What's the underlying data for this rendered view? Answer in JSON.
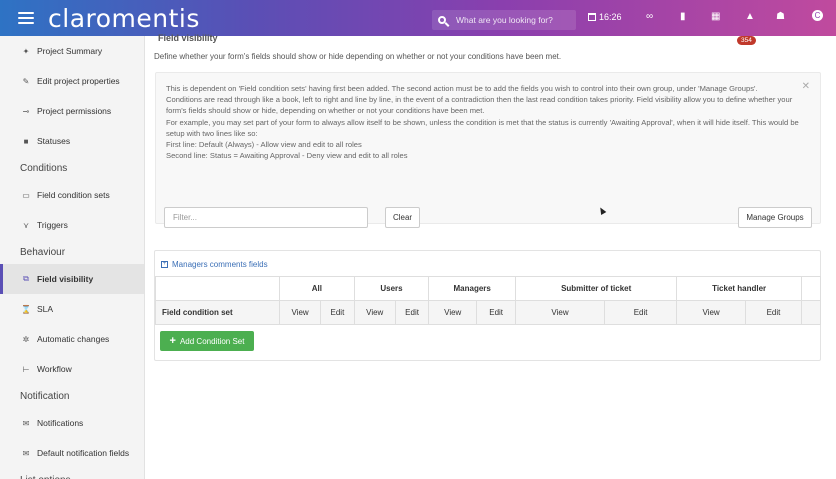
{
  "header": {
    "logo": "claromentis",
    "search_placeholder": "What are you looking for?",
    "time": "16:26",
    "notification_count": "354"
  },
  "sidebar": {
    "items": [
      {
        "label": "Project Summary",
        "icon": "pin-icon"
      },
      {
        "label": "Edit project properties",
        "icon": "pencil-icon"
      },
      {
        "label": "Project permissions",
        "icon": "key-icon"
      },
      {
        "label": "Statuses",
        "icon": "folder-icon"
      }
    ],
    "section_conditions": "Conditions",
    "conditions_items": [
      {
        "label": "Field condition sets",
        "icon": "rectangle-icon"
      },
      {
        "label": "Triggers",
        "icon": "trigger-icon"
      }
    ],
    "section_behaviour": "Behaviour",
    "behaviour_items": [
      {
        "label": "Field visibility",
        "icon": "visibility-icon",
        "active": true
      },
      {
        "label": "SLA",
        "icon": "hourglass-icon"
      },
      {
        "label": "Automatic changes",
        "icon": "magic-icon"
      },
      {
        "label": "Workflow",
        "icon": "flow-icon"
      }
    ],
    "section_notification": "Notification",
    "notification_items": [
      {
        "label": "Notifications",
        "icon": "envelope-icon"
      },
      {
        "label": "Default notification fields",
        "icon": "envelope-star-icon"
      }
    ],
    "section_list": "List options"
  },
  "main": {
    "title": "Field visibility",
    "description": "Define whether your form's fields should show or hide depending on whether or not your conditions have been met.",
    "info_lines": [
      "This is dependent on 'Field condition sets' having first been added. The second action must be to add the fields you wish to control into their own group, under 'Manage Groups'.",
      "Conditions are read through like a book, left to right and line by line, in the event of a contradiction then the last read condition takes priority. Field visibility allow you to define whether your form's fields should show or hide, depending on whether or not your conditions have been met.",
      "For example, you may set part of your form to always allow itself to be shown, unless the condition is met that the status is currently 'Awaiting Approval', when it will hide itself. This would be setup with two lines like so:",
      "First line: Default (Always) - Allow view and edit to all roles",
      "Second line: Status = Awaiting Approval - Deny view and edit to all roles"
    ],
    "filter_placeholder": "Filter...",
    "clear_label": "Clear",
    "manage_groups_label": "Manage Groups",
    "group_name": "Managers comments fields",
    "roles": [
      "All",
      "Users",
      "Managers",
      "Submitter of ticket",
      "Ticket handler"
    ],
    "first_column": "Field condition set",
    "view_label": "View",
    "edit_label": "Edit",
    "add_condition_label": "Add Condition Set"
  }
}
